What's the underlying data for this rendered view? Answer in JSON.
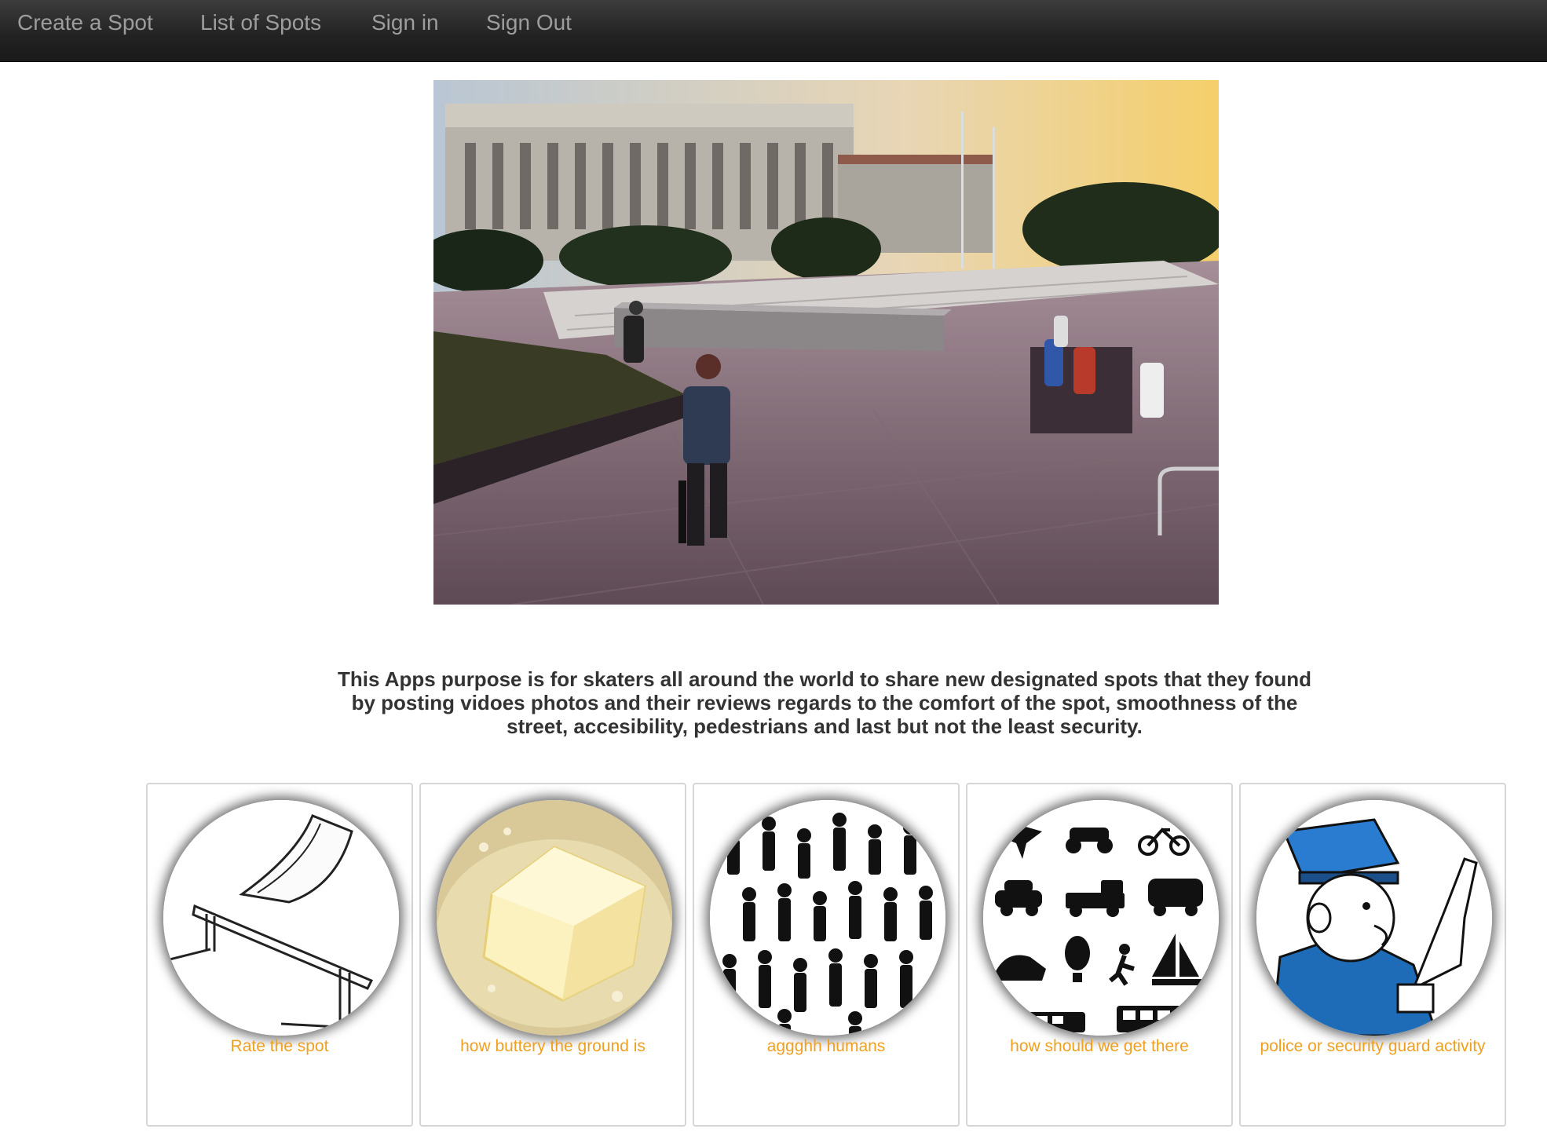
{
  "nav": {
    "items": [
      {
        "label": "Create a Spot"
      },
      {
        "label": "List of Spots"
      },
      {
        "label": "Sign in"
      },
      {
        "label": "Sign Out"
      }
    ]
  },
  "intro": {
    "line1": "This Apps purpose is for skaters all around the world to share new designated spots that they found",
    "line2": "by posting vidoes photos and their reviews regards to the comfort of the spot, smoothness of the",
    "line3": "street, accesibility, pedestrians and last but not the least security."
  },
  "cards": [
    {
      "label": "Rate the spot",
      "icon": "rail-ramp-icon"
    },
    {
      "label": "how buttery the ground is",
      "icon": "butter-icon"
    },
    {
      "label": "aggghh humans",
      "icon": "crowd-icon"
    },
    {
      "label": "how should we get there",
      "icon": "transport-icon"
    },
    {
      "label": "police or security guard activity",
      "icon": "police-icon"
    }
  ],
  "colors": {
    "navbar": "#222222",
    "nav_text": "#9d9d9d",
    "caption": "#f0a020",
    "police_blue": "#1e6bb8"
  }
}
